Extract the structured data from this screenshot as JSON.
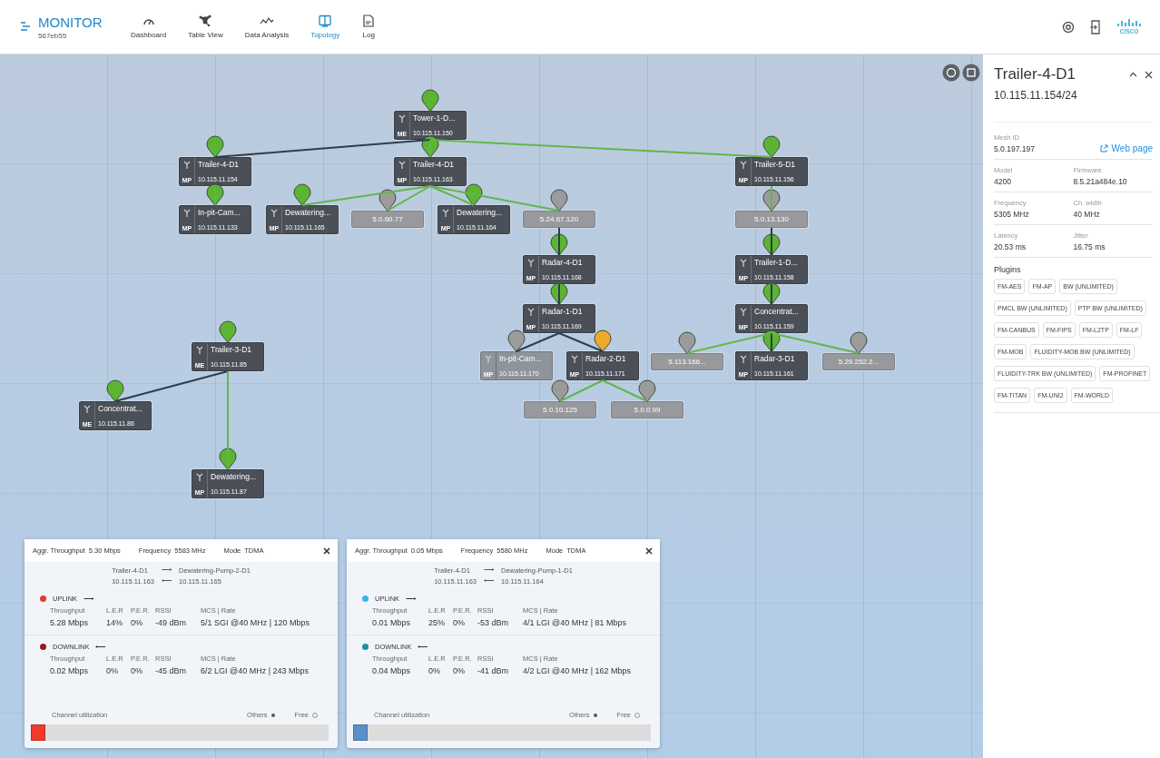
{
  "header": {
    "app_name": "MONITOR",
    "app_id": "567eb55",
    "nav": [
      {
        "label": "Dashboard",
        "selected": false
      },
      {
        "label": "Table View",
        "selected": false
      },
      {
        "label": "Data Analysis",
        "selected": false
      },
      {
        "label": "Topology",
        "selected": true
      },
      {
        "label": "Log",
        "selected": false
      }
    ],
    "logo": "cisco"
  },
  "topology": {
    "trees": [
      {
        "kind": "device",
        "name": "Tower-1-D...",
        "role": "ME",
        "ip": "10.115.11.150",
        "color": "#5cb531",
        "faded": false,
        "children": [
          {
            "kind": "device",
            "name": "Trailer-4-D1",
            "role": "MP",
            "ip": "10.115.11.154",
            "color": "#5cb531",
            "link": {
              "color": "#2c3e50"
            },
            "faded": false,
            "children": [
              {
                "kind": "device",
                "name": "In-pit-Cam...",
                "role": "MP",
                "ip": "10.115.11.133",
                "color": "#5cb531",
                "link": {
                  "color": "#62b64a"
                },
                "faded": false
              }
            ]
          },
          {
            "kind": "device",
            "name": "Trailer-4-D1",
            "role": "MP",
            "ip": "10.115.11.163",
            "color": "#5cb531",
            "link": {
              "color": "#62b64a"
            },
            "faded": false,
            "children": [
              {
                "kind": "device",
                "name": "Dewatering...",
                "role": "MP",
                "ip": "10.115.11.165",
                "color": "#5cb531",
                "link": {
                  "color": "#62b64a"
                },
                "faded": false
              },
              {
                "kind": "address",
                "label": "5.0.60.77",
                "color": "#9b9b9b",
                "link": {
                  "color": "#62b64a"
                },
                "faded": false
              },
              {
                "kind": "device",
                "name": "Dewatering...",
                "role": "MP",
                "ip": "10.115.11.164",
                "color": "#5cb531",
                "link": {
                  "color": "#62b64a"
                },
                "faded": false
              },
              {
                "kind": "address",
                "label": "5.24.67.120",
                "color": "#9b9b9b",
                "link": {
                  "color": "#62b64a"
                },
                "faded": false,
                "children": [
                  {
                    "kind": "device",
                    "name": "Radar-4-D1",
                    "role": "MP",
                    "ip": "10.115.11.168",
                    "color": "#5cb531",
                    "link": {
                      "color": "#2c3e50"
                    },
                    "faded": false,
                    "children": [
                      {
                        "kind": "device",
                        "name": "Radar-1-D1",
                        "role": "MP",
                        "ip": "10.115.11.169",
                        "color": "#5cb531",
                        "link": {
                          "color": "#2c3e50"
                        },
                        "faded": false,
                        "children": [
                          {
                            "kind": "device",
                            "name": "In-pit-Cam...",
                            "role": "MP",
                            "ip": "10.115.11.170",
                            "color": "#9b9b9b",
                            "link": {
                              "color": "#2c3e50"
                            },
                            "faded": true
                          },
                          {
                            "kind": "device",
                            "name": "Radar-2-D1",
                            "role": "MP",
                            "ip": "10.115.11.171",
                            "color": "#f0a92a",
                            "link": {
                              "color": "#2c3e50"
                            },
                            "faded": false,
                            "children": [
                              {
                                "kind": "address",
                                "label": "5.0.10.125",
                                "color": "#9b9b9b",
                                "link": {
                                  "color": "#62b64a"
                                },
                                "faded": false
                              },
                              {
                                "kind": "address",
                                "label": "5.0.0.99",
                                "color": "#9b9b9b",
                                "link": {
                                  "color": "#62b64a"
                                },
                                "faded": false
                              }
                            ]
                          }
                        ]
                      }
                    ]
                  }
                ]
              }
            ]
          },
          {
            "kind": "device",
            "name": "Trailer-5-D1",
            "role": "MP",
            "ip": "10.115.11.156",
            "color": "#5cb531",
            "link": {
              "color": "#62b64a"
            },
            "faded": false,
            "children": [
              {
                "kind": "address",
                "label": "5.0.13.130",
                "color": "#9b9b9b",
                "link": {
                  "color": "#62b64a"
                },
                "faded": false,
                "children": [
                  {
                    "kind": "device",
                    "name": "Trailer-1-D...",
                    "role": "MP",
                    "ip": "10.115.11.158",
                    "color": "#5cb531",
                    "link": {
                      "color": "#2c3e50"
                    },
                    "faded": false,
                    "children": [
                      {
                        "kind": "device",
                        "name": "Concentrat...",
                        "role": "MP",
                        "ip": "10.115.11.159",
                        "color": "#5cb531",
                        "link": {
                          "color": "#2c3e50"
                        },
                        "faded": false,
                        "children": [
                          {
                            "kind": "address",
                            "label": "5.113.166...",
                            "color": "#9b9b9b",
                            "link": {
                              "color": "#62b64a"
                            },
                            "faded": false
                          },
                          {
                            "kind": "device",
                            "name": "Radar-3-D1",
                            "role": "MP",
                            "ip": "10.115.11.161",
                            "color": "#5cb531",
                            "link": {
                              "color": "#2c3e50"
                            },
                            "faded": false
                          },
                          {
                            "kind": "address",
                            "label": "5.29.252.2...",
                            "color": "#9b9b9b",
                            "link": {
                              "color": "#62b64a"
                            },
                            "faded": false
                          }
                        ]
                      }
                    ]
                  }
                ]
              }
            ]
          }
        ]
      },
      {
        "kind": "device",
        "name": "Trailer-3-D1",
        "role": "ME",
        "ip": "10.115.11.85",
        "color": "#5cb531",
        "faded": false,
        "children": [
          {
            "kind": "device",
            "name": "Concentrat...",
            "role": "ME",
            "ip": "10.115.11.86",
            "color": "#5cb531",
            "link": {
              "color": "#2c3e50"
            },
            "faded": false
          },
          {
            "kind": "device",
            "name": "Dewatering...",
            "role": "MP",
            "ip": "10.115.11.87",
            "color": "#5cb531",
            "link": {
              "color": "#62b64a"
            },
            "faded": false
          }
        ]
      }
    ]
  },
  "link_panels": [
    {
      "stats": [
        {
          "label": "Aggr. Throughput",
          "value": "5.30 Mbps"
        },
        {
          "label": "Frequency",
          "value": "5583 MHz"
        },
        {
          "label": "Mode",
          "value": "TDMA"
        }
      ],
      "route": {
        "source": "Trailer-4-D1",
        "forward_arrow": "⟶",
        "target": "Dewatering-Pump-2-D1",
        "source_ip": "10.115.11.163",
        "back_arrow": "⟵",
        "target_ip": "10.115.11.165"
      },
      "directions": [
        {
          "title": "UPLINK",
          "arrow": "⟶",
          "color": "#e8352b",
          "columns": [
            "Throughput",
            "L.E.R",
            "P.E.R.",
            "RSSI",
            "MCS | Rate"
          ],
          "values": [
            "5.28 Mbps",
            "14%",
            "0%",
            "-49 dBm",
            "5/1 SGI @40 MHz | 120 Mbps"
          ]
        },
        {
          "title": "DOWNLINK",
          "arrow": "⟵",
          "color": "#9b1b1b",
          "columns": [
            "Throughput",
            "L.E.R",
            "P.E.R.",
            "RSSI",
            "MCS | Rate"
          ],
          "values": [
            "0.02 Mbps",
            "0%",
            "0%",
            "-45 dBm",
            "6/2 LGI @40 MHz | 243 Mbps"
          ]
        }
      ],
      "utilization": {
        "label": "Channel utilization",
        "legend": [
          "Others",
          "Free"
        ],
        "level": 0.05,
        "color": "#f03a2a"
      }
    },
    {
      "stats": [
        {
          "label": "Aggr. Throughput",
          "value": "0.05 Mbps"
        },
        {
          "label": "Frequency",
          "value": "5580 MHz"
        },
        {
          "label": "Mode",
          "value": "TDMA"
        }
      ],
      "route": {
        "source": "Trailer-4-D1",
        "forward_arrow": "⟶",
        "target": "Dewatering-Pump-1-D1",
        "source_ip": "10.115.11.163",
        "back_arrow": "⟵",
        "target_ip": "10.115.11.164"
      },
      "directions": [
        {
          "title": "UPLINK",
          "arrow": "⟶",
          "color": "#37b6e6",
          "columns": [
            "Throughput",
            "L.E.R",
            "P.E.R.",
            "RSSI",
            "MCS | Rate"
          ],
          "values": [
            "0.01 Mbps",
            "25%",
            "0%",
            "-53 dBm",
            "4/1 LGI @40 MHz | 81 Mbps"
          ]
        },
        {
          "title": "DOWNLINK",
          "arrow": "⟵",
          "color": "#1a8fa0",
          "columns": [
            "Throughput",
            "L.E.R",
            "P.E.R.",
            "RSSI",
            "MCS | Rate"
          ],
          "values": [
            "0.04 Mbps",
            "0%",
            "0%",
            "-41 dBm",
            "4/2 LGI @40 MHz | 162 Mbps"
          ]
        }
      ],
      "utilization": {
        "label": "Channel utilization",
        "legend": [
          "Others",
          "Free"
        ],
        "level": 0.05,
        "color": "#5b8fc9"
      }
    }
  ],
  "details": {
    "title": "Trailer-4-D1",
    "subtitle": "10.115.11.154/24",
    "mesh": {
      "label": "Mesh ID",
      "value": "5.0.197.197"
    },
    "web_link": "Web page",
    "fields": [
      [
        {
          "label": "Model",
          "value": "4200"
        },
        {
          "label": "Firmware",
          "value": "8.5.21a484e.10"
        }
      ],
      [
        {
          "label": "Frequency",
          "value": "5305 MHz"
        },
        {
          "label": "Ch. width",
          "value": "40 MHz"
        }
      ],
      [
        {
          "label": "Latency",
          "value": "20.53 ms"
        },
        {
          "label": "Jitter",
          "value": "16.75 ms"
        }
      ]
    ],
    "plugins_label": "Plugins",
    "plugins": [
      "FM-AES",
      "FM-AP",
      "BW (UNLIMITED)",
      "PMCL BW (UNLIMITED)",
      "PTP BW (UNLIMITED)",
      "FM-CANBUS",
      "FM-FIPS",
      "FM-L2TP",
      "FM-LF",
      "FM-MOB",
      "FLUIDITY-MOB BW (UNLIMITED)",
      "FLUIDITY-TRK BW (UNLIMITED)",
      "FM-PROFINET",
      "FM-TITAN",
      "FM-UNI2",
      "FM-WORLD"
    ]
  }
}
